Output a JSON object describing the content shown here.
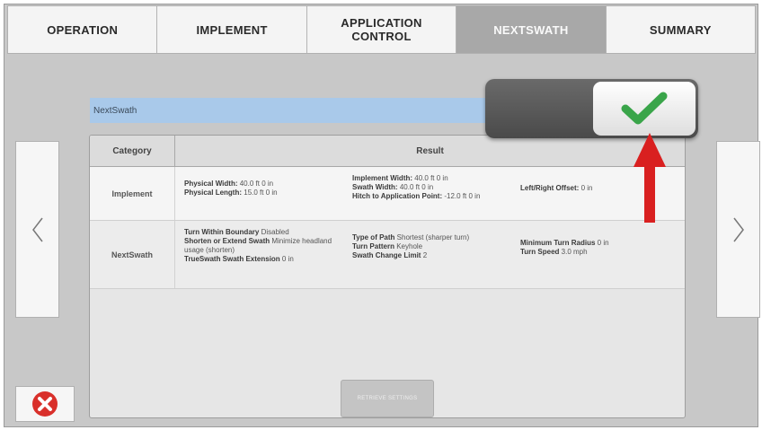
{
  "tabs": [
    {
      "label": "OPERATION"
    },
    {
      "label": "IMPLEMENT"
    },
    {
      "label": "APPLICATION\nCONTROL"
    },
    {
      "label": "NEXTSWATH"
    },
    {
      "label": "SUMMARY"
    }
  ],
  "active_tab": "NEXTSWATH",
  "title_bar": "NextSwath",
  "table": {
    "headers": [
      "Category",
      "Result"
    ],
    "rows": [
      {
        "category": "Implement",
        "col1": [
          {
            "label": "Physical Width:",
            "value": "40.0 ft 0 in"
          },
          {
            "label": "Physical Length:",
            "value": "15.0 ft 0 in"
          }
        ],
        "col2": [
          {
            "label": "Implement Width:",
            "value": "40.0 ft 0 in"
          },
          {
            "label": "Swath Width:",
            "value": "40.0 ft 0 in"
          },
          {
            "label": "Hitch to Application Point:",
            "value": "-12.0 ft 0 in"
          }
        ],
        "col3": [
          {
            "label": "Left/Right Offset:",
            "value": "0 in"
          }
        ]
      },
      {
        "category": "NextSwath",
        "col1": [
          {
            "label": "Turn Within Boundary",
            "value": "Disabled"
          },
          {
            "label": "Shorten or Extend Swath",
            "value": "Minimize headland usage (shorten)"
          },
          {
            "label": "TrueSwath Swath Extension",
            "value": "0 in"
          }
        ],
        "col2": [
          {
            "label": "Type of Path",
            "value": "Shortest (sharper turn)"
          },
          {
            "label": "Turn Pattern",
            "value": "Keyhole"
          },
          {
            "label": "Swath Change Limit",
            "value": "2"
          }
        ],
        "col3": [
          {
            "label": "Minimum Turn Radius",
            "value": "0 in"
          },
          {
            "label": "Turn Speed",
            "value": "3.0 mph"
          }
        ]
      }
    ]
  },
  "retrieve_button": "RETRIEVE SETTINGS",
  "icons": {
    "confirm": "checkmark-icon",
    "cancel": "close-circle-icon",
    "prev": "chevron-left-icon",
    "next": "chevron-right-icon"
  },
  "colors": {
    "title_bar": "#a9c9ea",
    "check": "#3aa54a",
    "cancel": "#d9302b",
    "annotation_arrow": "#d92020",
    "active_tab": "#a8a8a8"
  }
}
